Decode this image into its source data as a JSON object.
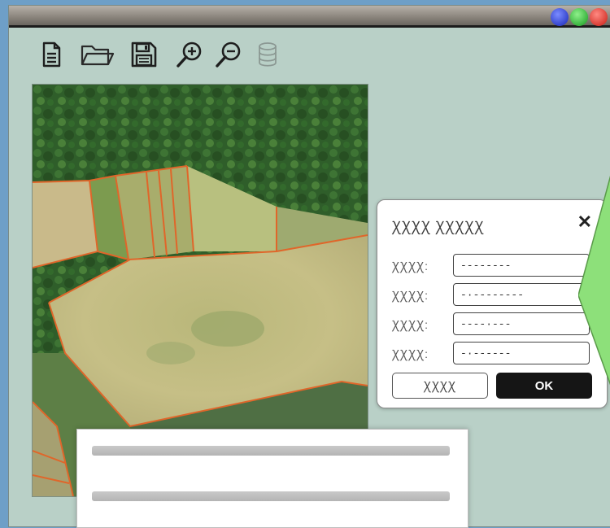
{
  "window": {
    "controls": [
      "minimize-blue",
      "maximize-green",
      "close-red"
    ]
  },
  "toolbar": {
    "items": [
      {
        "name": "new-document",
        "icon": "document-icon"
      },
      {
        "name": "open-folder",
        "icon": "folder-icon"
      },
      {
        "name": "save",
        "icon": "floppy-disk-icon"
      },
      {
        "name": "zoom-in",
        "icon": "zoom-in-icon"
      },
      {
        "name": "zoom-out",
        "icon": "zoom-out-icon"
      },
      {
        "name": "database",
        "icon": "database-icon",
        "disabled": true
      }
    ]
  },
  "dialog": {
    "title": "ꞳꞳꞳꞳ ꞳꞳꞳꞳꞳ",
    "close": "✕",
    "fields": [
      {
        "label": "ꞳꞳꞳꞳ:",
        "value": "--------"
      },
      {
        "label": "ꞳꞳꞳꞳ:",
        "value": "-·--------"
      },
      {
        "label": "ꞳꞳꞳꞳ:",
        "value": "----·---"
      },
      {
        "label": "ꞳꞳꞳꞳ:",
        "value": "-·------"
      }
    ],
    "cancel_label": "ꞳꞳꞳꞳ",
    "ok_label": "OK"
  },
  "colors": {
    "window_bg": "#b9d0c7",
    "ok_button": "#151515",
    "callout": "#8de07a",
    "field_boundary": "#e0662a"
  }
}
